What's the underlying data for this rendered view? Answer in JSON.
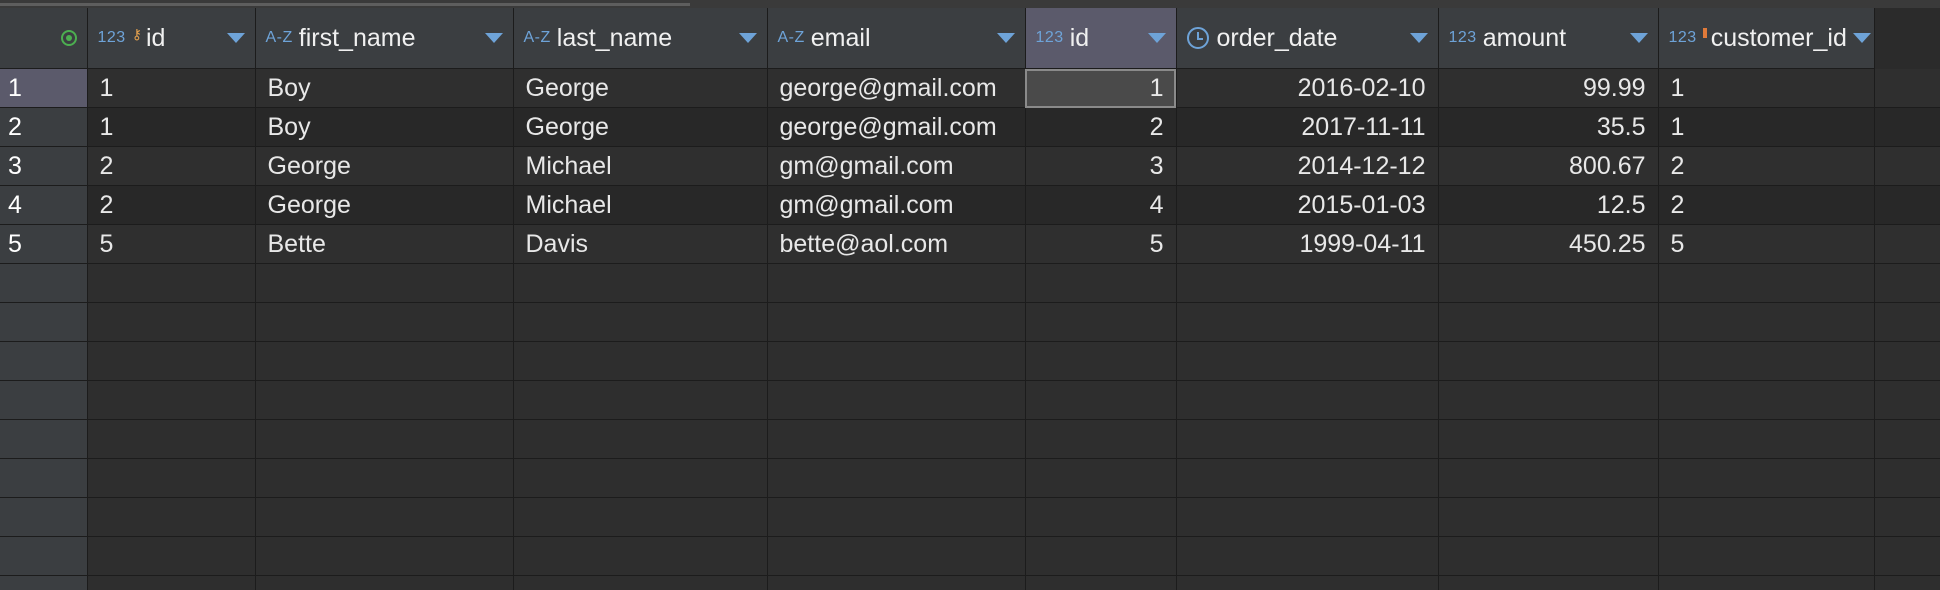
{
  "columns": [
    {
      "name": "id",
      "type": "123",
      "marker": "key",
      "align": "left"
    },
    {
      "name": "first_name",
      "type": "A-Z",
      "marker": "",
      "align": "left"
    },
    {
      "name": "last_name",
      "type": "A-Z",
      "marker": "",
      "align": "left"
    },
    {
      "name": "email",
      "type": "A-Z",
      "marker": "",
      "align": "left"
    },
    {
      "name": "id",
      "type": "123",
      "marker": "",
      "align": "right"
    },
    {
      "name": "order_date",
      "type": "clock",
      "marker": "",
      "align": "right"
    },
    {
      "name": "amount",
      "type": "123",
      "marker": "",
      "align": "right"
    },
    {
      "name": "customer_id",
      "type": "123",
      "marker": "foreign-key",
      "align": "left"
    }
  ],
  "rows": [
    {
      "num": "1",
      "cells": [
        "1",
        "Boy",
        "George",
        "george@gmail.com",
        "1",
        "2016-02-10",
        "99.99",
        "1"
      ]
    },
    {
      "num": "2",
      "cells": [
        "1",
        "Boy",
        "George",
        "george@gmail.com",
        "2",
        "2017-11-11",
        "35.5",
        "1"
      ]
    },
    {
      "num": "3",
      "cells": [
        "2",
        "George",
        "Michael",
        "gm@gmail.com",
        "3",
        "2014-12-12",
        "800.67",
        "2"
      ]
    },
    {
      "num": "4",
      "cells": [
        "2",
        "George",
        "Michael",
        "gm@gmail.com",
        "4",
        "2015-01-03",
        "12.5",
        "2"
      ]
    },
    {
      "num": "5",
      "cells": [
        "5",
        "Bette",
        "Davis",
        "bette@aol.com",
        "5",
        "1999-04-11",
        "450.25",
        "5"
      ]
    }
  ],
  "icons": {
    "corner": "row-status-icon",
    "sort": "sort-dropdown-icon",
    "key": "primary-key-icon",
    "foreign_key": "foreign-key-icon",
    "date": "clock-icon"
  },
  "colors": {
    "accent": "#6ea3d8",
    "key": "#e3a04d",
    "foreign_key": "#e07a3a",
    "status": "#4caf50"
  }
}
